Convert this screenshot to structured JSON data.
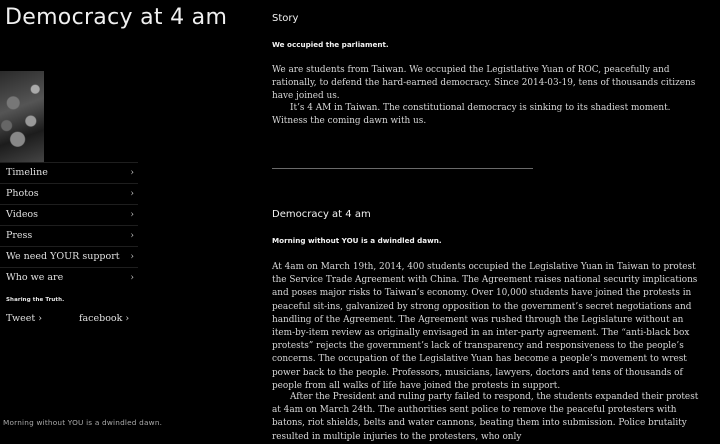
{
  "site": {
    "title": "Democracy at 4 am",
    "tagline": "Morning without YOU is a dwindled dawn."
  },
  "nav": {
    "chevron": "›",
    "items": [
      {
        "label": "Timeline"
      },
      {
        "label": "Photos"
      },
      {
        "label": "Videos"
      },
      {
        "label": "Press"
      },
      {
        "label": "We need YOUR support"
      },
      {
        "label": "Who we are"
      }
    ]
  },
  "share": {
    "heading": "Sharing the Truth.",
    "tweet": "Tweet ›",
    "facebook": "facebook ›"
  },
  "story": {
    "title": "Story",
    "subtitle": "We occupied the parliament.",
    "p1": "We are students from Taiwan. We occupied the Legistlative Yuan of ROC, peacefully and rationally, to defend the hard-earned democracy. Since 2014-03-19, tens of thousands citizens have joined us.",
    "p2": "It’s 4 AM in Taiwan. The constitutional democracy is sinking to its shadiest moment. Witness the coming dawn with us."
  },
  "article": {
    "title": "Democracy at 4 am",
    "subtitle": "Morning without YOU is a dwindled dawn.",
    "p1": "At 4am on March 19th, 2014, 400 students occupied the Legislative Yuan in Taiwan to protest the Service Trade Agreement with China. The Agreement raises national security implications and poses major risks to Taiwan’s economy. Over 10,000 students have joined the protests in peaceful sit-ins, galvanized by strong opposition to the government’s secret negotiations and handling of the Agreement. The Agreement was rushed through the Legislature without an item-by-item review as originally envisaged in an inter-party agreement. The “anti-black box protests” rejects the government’s lack of transparency and responsiveness to the people’s concerns. The occupation of the Legislative Yuan has become a people’s movement to wrest power back to the people. Professors, musicians, lawyers, doctors and tens of thousands of people from all walks of life have joined the protests in support.",
    "p2": "After the President and ruling party failed to respond, the students expanded their protest at 4am on March 24th. The authorities sent police to remove the peaceful protesters with batons, riot shields, belts and water cannons, beating them into submission. Police brutality resulted in multiple injuries to the protesters, who only"
  }
}
